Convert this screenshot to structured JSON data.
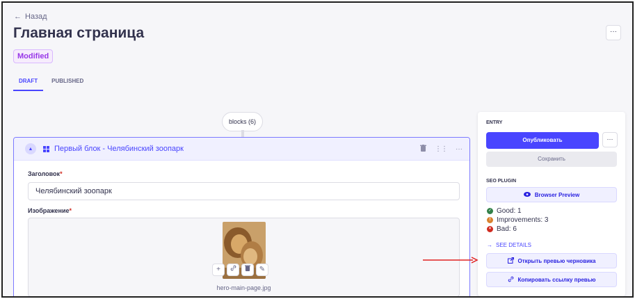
{
  "header": {
    "back_label": "Назад",
    "title": "Главная страница",
    "status_badge": "Modified",
    "more_label": "···"
  },
  "tabs": [
    {
      "label": "DRAFT",
      "active": true
    },
    {
      "label": "PUBLISHED",
      "active": false
    }
  ],
  "blocks_pill": "blocks (6)",
  "block": {
    "title": "Первый блок - Челябинский зоопарк",
    "fields": {
      "heading_label": "Заголовок",
      "heading_value": "Челябинский зоопарк",
      "image_label": "Изображение",
      "required_mark": "*",
      "image_filename": "hero-main-page.jpg"
    }
  },
  "sidebar": {
    "entry_heading": "ENTRY",
    "publish_label": "Опубликовать",
    "more_label": "···",
    "save_label": "Сохранить",
    "seo_heading": "SEO PLUGIN",
    "browser_preview_label": "Browser Preview",
    "seo_good": "Good: 1",
    "seo_improvements": "Improvements: 3",
    "seo_bad": "Bad: 6",
    "see_details_label": "SEE DETAILS",
    "open_draft_preview_label": "Открыть превью черновика",
    "copy_preview_link_label": "Копировать ссылку превью"
  },
  "colors": {
    "primary": "#4945ff",
    "good": "#328048",
    "improvements": "#d9822f",
    "bad": "#d02b20",
    "annotation_arrow": "#e02020"
  }
}
